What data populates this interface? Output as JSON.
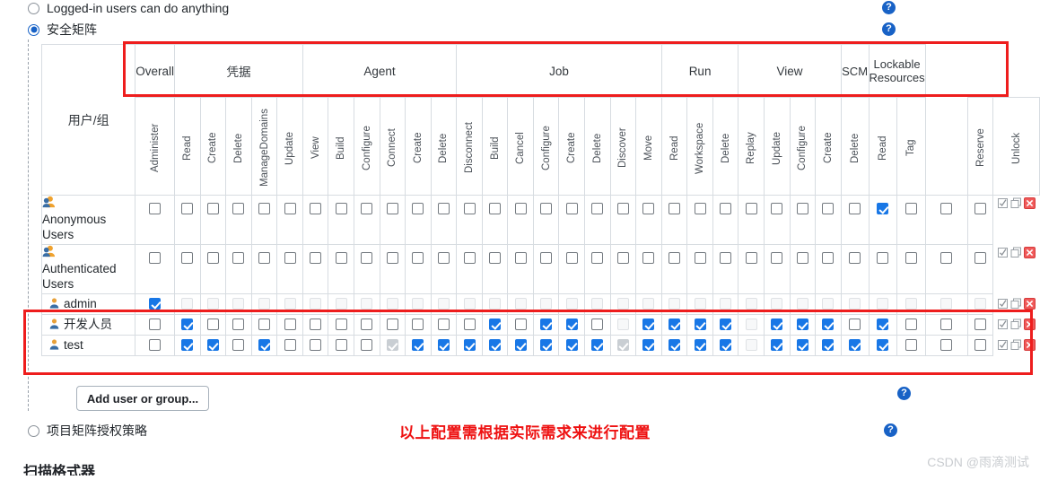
{
  "options": {
    "logged_in_label": "Logged-in users can do anything",
    "security_matrix_label": "安全矩阵",
    "project_matrix_label": "项目矩阵授权策略"
  },
  "matrix": {
    "user_column_header": "用户/组",
    "groups": [
      {
        "label": "Overall",
        "span": 1
      },
      {
        "label": "凭据",
        "span": 5
      },
      {
        "label": "Agent",
        "span": 6
      },
      {
        "label": "Job",
        "span": 8
      },
      {
        "label": "Run",
        "span": 3
      },
      {
        "label": "View",
        "span": 4
      },
      {
        "label": "SCM",
        "span": 1
      },
      {
        "label": "Lockable Resources",
        "span": 2
      }
    ],
    "columns": [
      "Administer",
      "Read",
      "Create",
      "Delete",
      "ManageDomains",
      "Update",
      "View",
      "Build",
      "Configure",
      "Connect",
      "Create",
      "Delete",
      "Disconnect",
      "Build",
      "Cancel",
      "Configure",
      "Create",
      "Delete",
      "Discover",
      "Move",
      "Read",
      "Workspace",
      "Delete",
      "Replay",
      "Update",
      "Configure",
      "Create",
      "Delete",
      "Read",
      "Tag",
      "Reserve",
      "Unlock"
    ],
    "rows": [
      {
        "name": "Anonymous Users",
        "icon": "group-icon",
        "tall": true,
        "states": [
          "off",
          "off",
          "off",
          "off",
          "off",
          "off",
          "off",
          "off",
          "off",
          "off",
          "off",
          "off",
          "off",
          "off",
          "off",
          "off",
          "off",
          "off",
          "off",
          "off",
          "off",
          "off",
          "off",
          "off",
          "off",
          "off",
          "off",
          "off",
          "on",
          "off",
          "off",
          "off"
        ]
      },
      {
        "name": "Authenticated Users",
        "icon": "group-icon",
        "tall": true,
        "states": [
          "off",
          "off",
          "off",
          "off",
          "off",
          "off",
          "off",
          "off",
          "off",
          "off",
          "off",
          "off",
          "off",
          "off",
          "off",
          "off",
          "off",
          "off",
          "off",
          "off",
          "off",
          "off",
          "off",
          "off",
          "off",
          "off",
          "off",
          "off",
          "off",
          "off",
          "off",
          "off"
        ]
      },
      {
        "name": "admin",
        "icon": "user-icon",
        "tall": false,
        "states": [
          "on",
          "dis",
          "dis",
          "dis",
          "dis",
          "dis",
          "dis",
          "dis",
          "dis",
          "dis",
          "dis",
          "dis",
          "dis",
          "dis",
          "dis",
          "dis",
          "dis",
          "dis",
          "dis",
          "dis",
          "dis",
          "dis",
          "dis",
          "dis",
          "dis",
          "dis",
          "dis",
          "dis",
          "dis",
          "dis",
          "dis",
          "dis"
        ]
      },
      {
        "name": "开发人员",
        "icon": "user-icon",
        "tall": false,
        "states": [
          "off",
          "on",
          "off",
          "off",
          "off",
          "off",
          "off",
          "off",
          "off",
          "off",
          "off",
          "off",
          "off",
          "on",
          "off",
          "on",
          "on",
          "off",
          "dis",
          "on",
          "on",
          "on",
          "on",
          "dis",
          "on",
          "on",
          "on",
          "off",
          "on",
          "off",
          "off",
          "off"
        ]
      },
      {
        "name": "test",
        "icon": "user-icon",
        "tall": false,
        "states": [
          "off",
          "on",
          "on",
          "off",
          "on",
          "off",
          "off",
          "off",
          "off",
          "dison",
          "on",
          "on",
          "on",
          "on",
          "on",
          "on",
          "on",
          "on",
          "dison",
          "on",
          "on",
          "on",
          "on",
          "dis",
          "on",
          "on",
          "on",
          "on",
          "on",
          "off",
          "off",
          "off"
        ]
      }
    ],
    "row_actions": [
      "select-all-icon",
      "copy-icon",
      "remove-icon"
    ]
  },
  "buttons": {
    "add_user_or_group": "Add user or group..."
  },
  "annotation": {
    "note_text": "以上配置需根据实际需求来进行配置",
    "note_color": "#ee1111"
  },
  "bottom_heading": "扫描格式器",
  "watermark": "CSDN @雨滴测试",
  "help_icon_glyph": "?"
}
